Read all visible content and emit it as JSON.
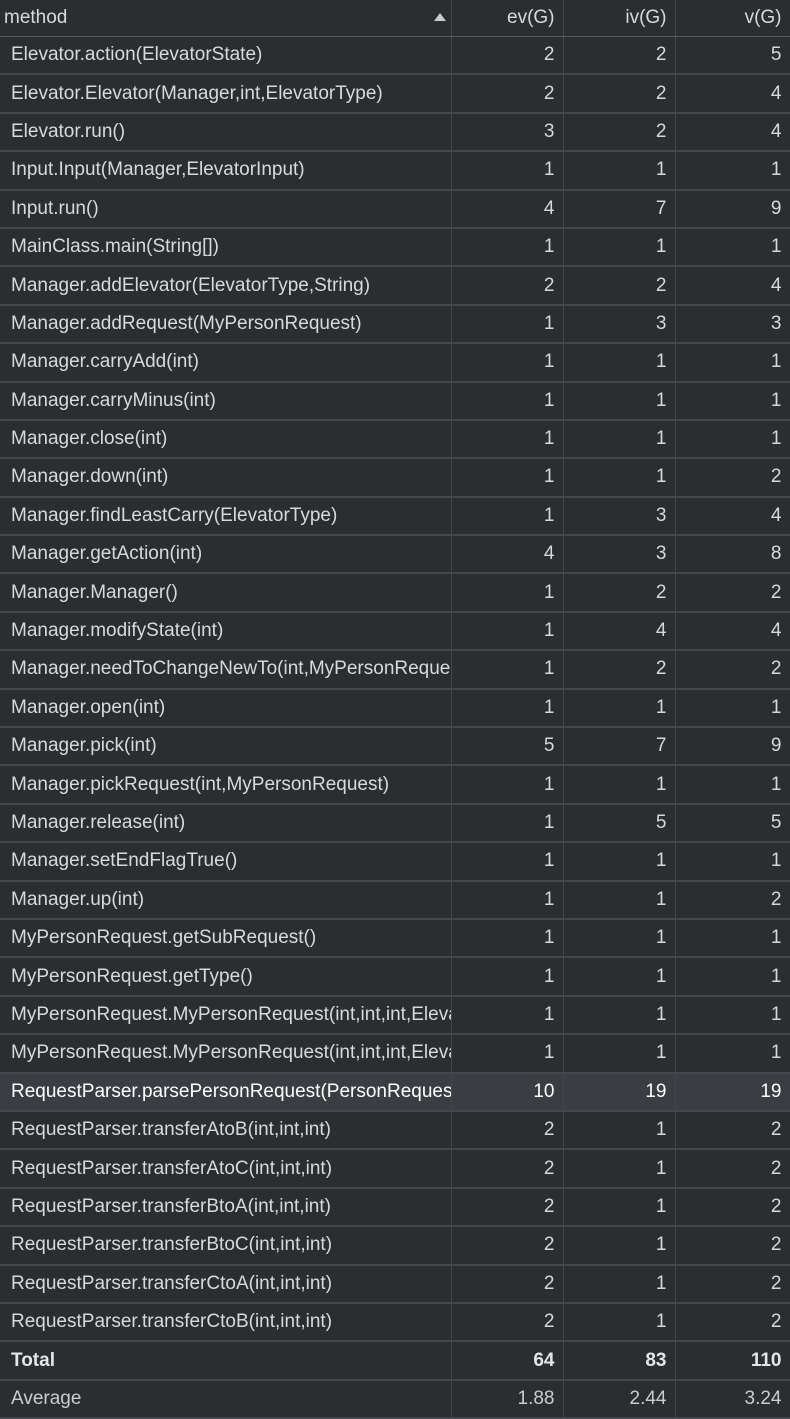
{
  "table": {
    "headers": {
      "method": "method",
      "ev": "ev(G)",
      "iv": "iv(G)",
      "v": "v(G)"
    },
    "sort": {
      "column": "method",
      "direction": "ascending",
      "icon": "sort-ascending-icon"
    },
    "selected_row_index": 27,
    "rows": [
      {
        "method": "Elevator.action(ElevatorState)",
        "ev": "2",
        "iv": "2",
        "v": "5"
      },
      {
        "method": "Elevator.Elevator(Manager,int,ElevatorType)",
        "ev": "2",
        "iv": "2",
        "v": "4"
      },
      {
        "method": "Elevator.run()",
        "ev": "3",
        "iv": "2",
        "v": "4"
      },
      {
        "method": "Input.Input(Manager,ElevatorInput)",
        "ev": "1",
        "iv": "1",
        "v": "1"
      },
      {
        "method": "Input.run()",
        "ev": "4",
        "iv": "7",
        "v": "9"
      },
      {
        "method": "MainClass.main(String[])",
        "ev": "1",
        "iv": "1",
        "v": "1"
      },
      {
        "method": "Manager.addElevator(ElevatorType,String)",
        "ev": "2",
        "iv": "2",
        "v": "4"
      },
      {
        "method": "Manager.addRequest(MyPersonRequest)",
        "ev": "1",
        "iv": "3",
        "v": "3"
      },
      {
        "method": "Manager.carryAdd(int)",
        "ev": "1",
        "iv": "1",
        "v": "1"
      },
      {
        "method": "Manager.carryMinus(int)",
        "ev": "1",
        "iv": "1",
        "v": "1"
      },
      {
        "method": "Manager.close(int)",
        "ev": "1",
        "iv": "1",
        "v": "1"
      },
      {
        "method": "Manager.down(int)",
        "ev": "1",
        "iv": "1",
        "v": "2"
      },
      {
        "method": "Manager.findLeastCarry(ElevatorType)",
        "ev": "1",
        "iv": "3",
        "v": "4"
      },
      {
        "method": "Manager.getAction(int)",
        "ev": "4",
        "iv": "3",
        "v": "8"
      },
      {
        "method": "Manager.Manager()",
        "ev": "1",
        "iv": "2",
        "v": "2"
      },
      {
        "method": "Manager.modifyState(int)",
        "ev": "1",
        "iv": "4",
        "v": "4"
      },
      {
        "method": "Manager.needToChangeNewTo(int,MyPersonReque",
        "ev": "1",
        "iv": "2",
        "v": "2"
      },
      {
        "method": "Manager.open(int)",
        "ev": "1",
        "iv": "1",
        "v": "1"
      },
      {
        "method": "Manager.pick(int)",
        "ev": "5",
        "iv": "7",
        "v": "9"
      },
      {
        "method": "Manager.pickRequest(int,MyPersonRequest)",
        "ev": "1",
        "iv": "1",
        "v": "1"
      },
      {
        "method": "Manager.release(int)",
        "ev": "1",
        "iv": "5",
        "v": "5"
      },
      {
        "method": "Manager.setEndFlagTrue()",
        "ev": "1",
        "iv": "1",
        "v": "1"
      },
      {
        "method": "Manager.up(int)",
        "ev": "1",
        "iv": "1",
        "v": "2"
      },
      {
        "method": "MyPersonRequest.getSubRequest()",
        "ev": "1",
        "iv": "1",
        "v": "1"
      },
      {
        "method": "MyPersonRequest.getType()",
        "ev": "1",
        "iv": "1",
        "v": "1"
      },
      {
        "method": "MyPersonRequest.MyPersonRequest(int,int,int,Eleva",
        "ev": "1",
        "iv": "1",
        "v": "1"
      },
      {
        "method": "MyPersonRequest.MyPersonRequest(int,int,int,Eleva",
        "ev": "1",
        "iv": "1",
        "v": "1"
      },
      {
        "method": "RequestParser.parsePersonRequest(PersonRequest)",
        "ev": "10",
        "iv": "19",
        "v": "19"
      },
      {
        "method": "RequestParser.transferAtoB(int,int,int)",
        "ev": "2",
        "iv": "1",
        "v": "2"
      },
      {
        "method": "RequestParser.transferAtoC(int,int,int)",
        "ev": "2",
        "iv": "1",
        "v": "2"
      },
      {
        "method": "RequestParser.transferBtoA(int,int,int)",
        "ev": "2",
        "iv": "1",
        "v": "2"
      },
      {
        "method": "RequestParser.transferBtoC(int,int,int)",
        "ev": "2",
        "iv": "1",
        "v": "2"
      },
      {
        "method": "RequestParser.transferCtoA(int,int,int)",
        "ev": "2",
        "iv": "1",
        "v": "2"
      },
      {
        "method": "RequestParser.transferCtoB(int,int,int)",
        "ev": "2",
        "iv": "1",
        "v": "2"
      }
    ],
    "total": {
      "label": "Total",
      "ev": "64",
      "iv": "83",
      "v": "110"
    },
    "average": {
      "label": "Average",
      "ev": "1.88",
      "iv": "2.44",
      "v": "3.24"
    }
  }
}
